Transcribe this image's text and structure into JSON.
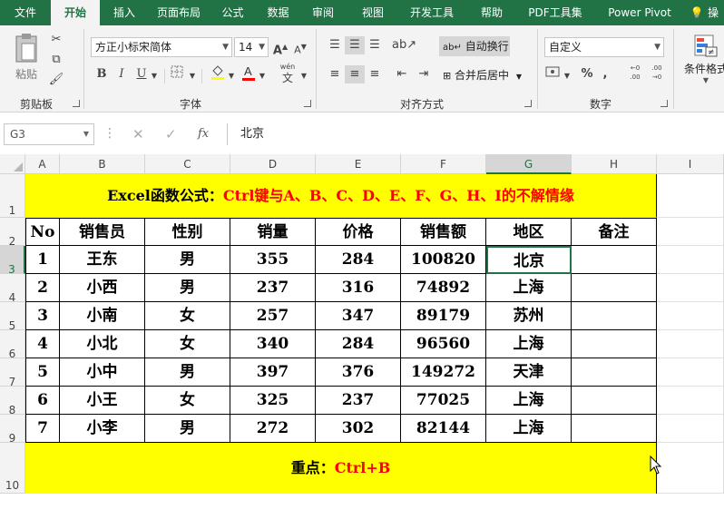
{
  "tabs": [
    "文件",
    "开始",
    "插入",
    "页面布局",
    "公式",
    "数据",
    "审阅",
    "视图",
    "开发工具",
    "帮助",
    "PDF工具集",
    "Power Pivot",
    "操"
  ],
  "ribbon": {
    "clipboard": {
      "paste": "粘贴",
      "label": "剪贴板"
    },
    "font": {
      "family": "方正小标宋简体",
      "size": "14",
      "bold": "B",
      "italic": "I",
      "underline": "U",
      "grow": "A",
      "shrink": "A",
      "wen": "wén",
      "wen_char": "文",
      "label": "字体"
    },
    "align": {
      "wrap": "自动换行",
      "merge": "合并后居中",
      "label": "对齐方式"
    },
    "number": {
      "format": "自定义",
      "percent": "%",
      "comma": ",",
      "inc": "←0 .00",
      "dec": ".00 →0",
      "label": "数字"
    },
    "styles": {
      "cond": "条件格式"
    }
  },
  "formula_bar": {
    "name_box": "G3",
    "fx": "fx",
    "value": "北京"
  },
  "columns": [
    "A",
    "B",
    "C",
    "D",
    "E",
    "F",
    "G",
    "H",
    "I"
  ],
  "rows": [
    "1",
    "2",
    "3",
    "4",
    "5",
    "6",
    "7",
    "8",
    "9",
    "10"
  ],
  "title": {
    "black": "Excel函数公式：",
    "red": "Ctrl键与A、B、C、D、E、F、G、H、I的不解情缘"
  },
  "headers": [
    "No",
    "销售员",
    "性别",
    "销量",
    "价格",
    "销售额",
    "地区",
    "备注"
  ],
  "table": [
    [
      "1",
      "王东",
      "男",
      "355",
      "284",
      "100820",
      "北京",
      ""
    ],
    [
      "2",
      "小西",
      "男",
      "237",
      "316",
      "74892",
      "上海",
      ""
    ],
    [
      "3",
      "小南",
      "女",
      "257",
      "347",
      "89179",
      "苏州",
      ""
    ],
    [
      "4",
      "小北",
      "女",
      "340",
      "284",
      "96560",
      "上海",
      ""
    ],
    [
      "5",
      "小中",
      "男",
      "397",
      "376",
      "149272",
      "天津",
      ""
    ],
    [
      "6",
      "小王",
      "女",
      "325",
      "237",
      "77025",
      "上海",
      ""
    ],
    [
      "7",
      "小李",
      "男",
      "272",
      "302",
      "82144",
      "上海",
      ""
    ]
  ],
  "footer": {
    "black": "重点：",
    "red": "Ctrl+B"
  },
  "colors": {
    "excel_green": "#217346",
    "highlight": "#ffff00",
    "red_text": "#ff0000"
  }
}
